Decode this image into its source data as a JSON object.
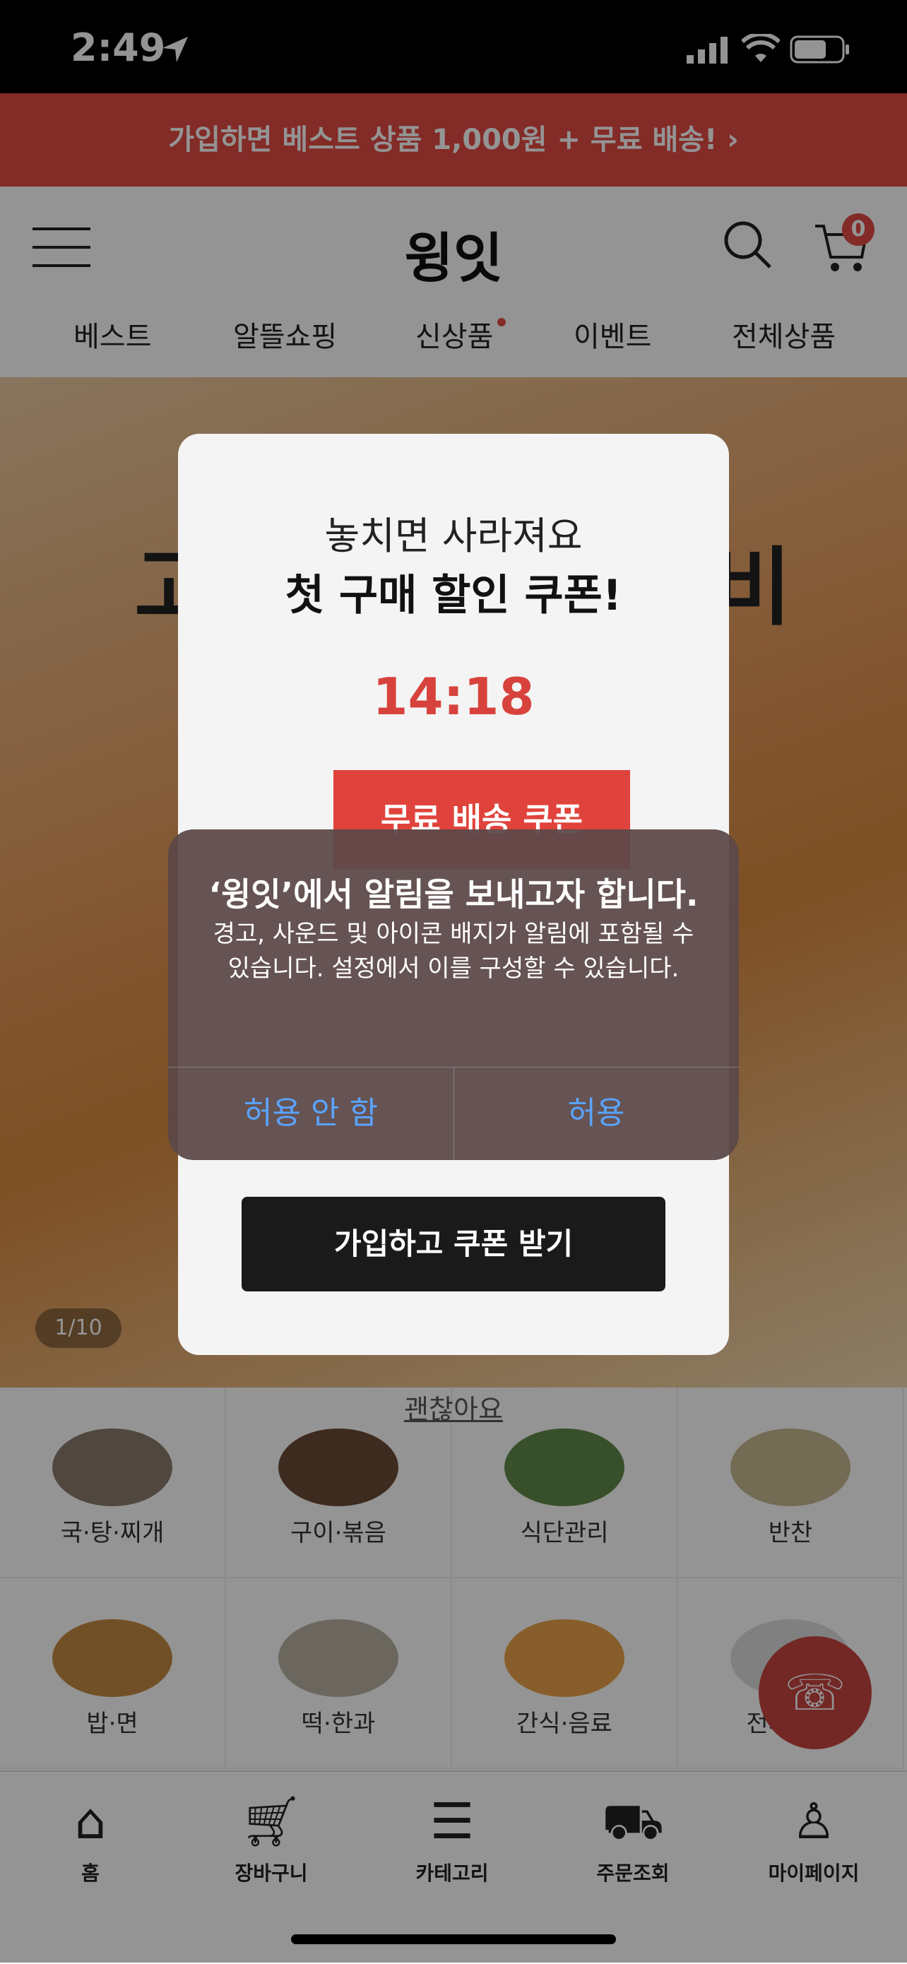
{
  "status": {
    "time": "2:49"
  },
  "promo": {
    "text": "가입하면 베스트 상품 1,000원 + 무료 배송! ›"
  },
  "header": {
    "logo": "윙잇",
    "cart_count": "0"
  },
  "nav": [
    "베스트",
    "알뜰쇼핑",
    "신상품",
    "이벤트",
    "전체상품"
  ],
  "hero": {
    "title_left": "고",
    "title_right": "비",
    "counter": "1/10"
  },
  "categories": [
    "국·탕·찌개",
    "구이·볶음",
    "식단관리",
    "반찬",
    "밥·면",
    "떡·한과",
    "간식·음료",
    "전체보기"
  ],
  "tabs": [
    {
      "label": "홈",
      "icon": "home-icon"
    },
    {
      "label": "장바구니",
      "icon": "cart-icon"
    },
    {
      "label": "카테고리",
      "icon": "list-icon"
    },
    {
      "label": "주문조회",
      "icon": "truck-icon"
    },
    {
      "label": "마이페이지",
      "icon": "person-icon"
    }
  ],
  "modal": {
    "subtitle": "놓치면 사라져요",
    "title": "첫 구매 할인 쿠폰!",
    "timer": "14:18",
    "coupon": "무료 배송 쿠폰",
    "join_button": "가입하고 쿠폰 받기",
    "dismiss": "괜찮아요"
  },
  "alert": {
    "title": "‘윙잇’에서 알림을 보내고자 합니다.",
    "message": "경고, 사운드 및 아이콘 배지가 알림에 포함될 수 있습니다. 설정에서 이를 구성할 수 있습니다.",
    "deny": "허용 안 함",
    "allow": "허용",
    "button_color": "#5aa4ff"
  },
  "colors": {
    "brand": "#e24b44",
    "accent_red": "#d7433c"
  }
}
